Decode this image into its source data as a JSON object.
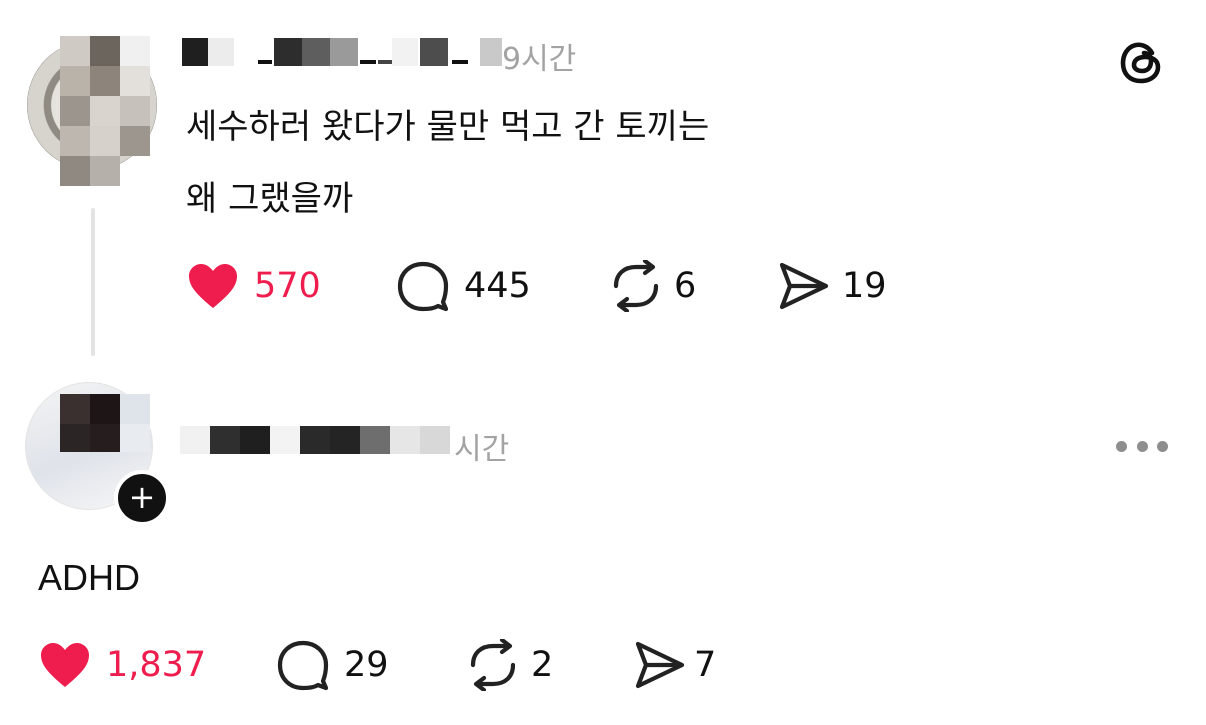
{
  "post": {
    "time_label": "9시간",
    "text_line1": "세수하러 왔다가 물만 먹고 간 토끼는",
    "text_line2": "왜 그랬을까",
    "likes": "570",
    "comments": "445",
    "reposts": "6",
    "shares": "19"
  },
  "reply": {
    "time_label": "시간",
    "text": "ADHD",
    "likes": "1,837",
    "comments": "29",
    "reposts": "2",
    "shares": "7"
  },
  "icons": {
    "heart": "heart-icon",
    "comment": "comment-icon",
    "repost": "repost-icon",
    "share": "share-icon",
    "logo": "threads-logo-icon",
    "follow": "plus-icon",
    "more": "more-icon"
  },
  "colors": {
    "like_red": "#ee1d4e",
    "text": "#111111",
    "muted": "#a3a3a3"
  }
}
